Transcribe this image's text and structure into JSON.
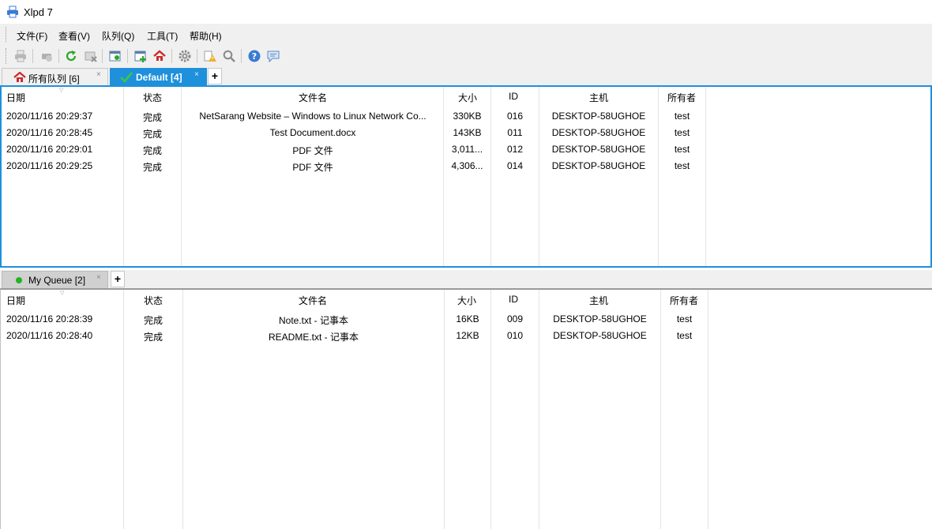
{
  "window": {
    "title": "Xlpd 7"
  },
  "menu": [
    "文件(F)",
    "查看(V)",
    "队列(Q)",
    "工具(T)",
    "帮助(H)"
  ],
  "toolbar_icons": [
    "print-icon",
    "print-disabled-icon",
    "refresh-icon",
    "delete-icon",
    "queue-settings-icon",
    "add-queue-icon",
    "home-queue-icon",
    "gear-icon",
    "alert-icon",
    "search-icon",
    "help-icon",
    "feedback-icon"
  ],
  "top_tabs": [
    {
      "label": "所有队列 [6]",
      "close": "×"
    },
    {
      "label": "Default [4]",
      "close": "×"
    }
  ],
  "bottom_tabs": [
    {
      "label": "My Queue [2]",
      "close": "×"
    }
  ],
  "add_tab": "+",
  "columns": [
    "日期",
    "状态",
    "文件名",
    "大小",
    "ID",
    "主机",
    "所有者"
  ],
  "top_rows": [
    [
      "2020/11/16 20:29:37",
      "完成",
      "NetSarang Website – Windows to Linux Network Co...",
      "330KB",
      "016",
      "DESKTOP-58UGHOE",
      "test"
    ],
    [
      "2020/11/16 20:28:45",
      "完成",
      "Test Document.docx",
      "143KB",
      "011",
      "DESKTOP-58UGHOE",
      "test"
    ],
    [
      "2020/11/16 20:29:01",
      "完成",
      "PDF 文件",
      "3,011...",
      "012",
      "DESKTOP-58UGHOE",
      "test"
    ],
    [
      "2020/11/16 20:29:25",
      "完成",
      "PDF 文件",
      "4,306...",
      "014",
      "DESKTOP-58UGHOE",
      "test"
    ]
  ],
  "bottom_rows": [
    [
      "2020/11/16 20:28:39",
      "完成",
      "Note.txt - 记事本",
      "16KB",
      "009",
      "DESKTOP-58UGHOE",
      "test"
    ],
    [
      "2020/11/16 20:28:40",
      "完成",
      "README.txt - 记事本",
      "12KB",
      "010",
      "DESKTOP-58UGHOE",
      "test"
    ]
  ],
  "colors": {
    "accent": "#1e90dc",
    "active_tab_check": "#3cc83c",
    "queue_dot": "#22b422"
  }
}
